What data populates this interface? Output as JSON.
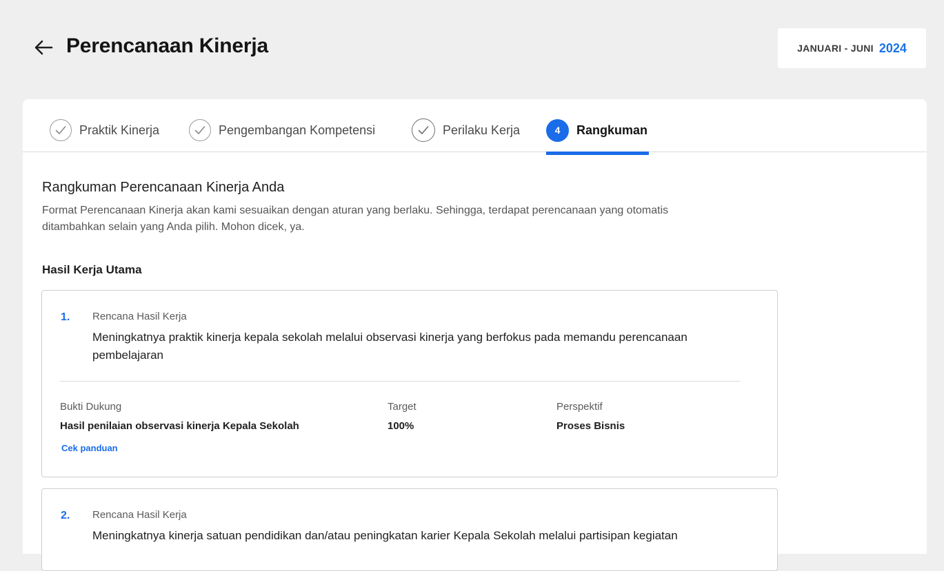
{
  "header": {
    "title": "Perencanaan Kinerja",
    "period_label": "JANUARI - JUNI",
    "period_year": "2024"
  },
  "stepper": {
    "steps": [
      {
        "label": "Praktik Kinerja",
        "status": "done"
      },
      {
        "label": "Pengembangan Kompetensi",
        "status": "done"
      },
      {
        "label": "Perilaku Kerja",
        "status": "done"
      },
      {
        "label": "Rangkuman",
        "status": "active",
        "number": "4"
      }
    ]
  },
  "summary": {
    "title": "Rangkuman Perencanaan Kinerja Anda",
    "description": "Format Perencanaan Kinerja akan kami sesuaikan dengan aturan yang berlaku. Sehingga, terdapat perencanaan yang otomatis ditambahkan selain yang Anda pilih. Mohon dicek, ya."
  },
  "section": {
    "title": "Hasil Kerja Utama"
  },
  "items": [
    {
      "number": "1.",
      "kind": "Rencana Hasil Kerja",
      "text": "Meningkatnya praktik kinerja kepala sekolah melalui observasi kinerja yang berfokus pada memandu perencanaan pembelajaran",
      "evidence_label": "Bukti Dukung",
      "evidence_value": "Hasil penilaian observasi kinerja Kepala Sekolah",
      "target_label": "Target",
      "target_value": "100%",
      "perspective_label": "Perspektif",
      "perspective_value": "Proses Bisnis",
      "guide_link": "Cek panduan"
    },
    {
      "number": "2.",
      "kind": "Rencana Hasil Kerja",
      "text": "Meningkatnya kinerja satuan pendidikan dan/atau peningkatan karier Kepala Sekolah melalui partisipan kegiatan"
    }
  ],
  "colors": {
    "accent": "#1a6ce8",
    "background": "#efefef"
  }
}
